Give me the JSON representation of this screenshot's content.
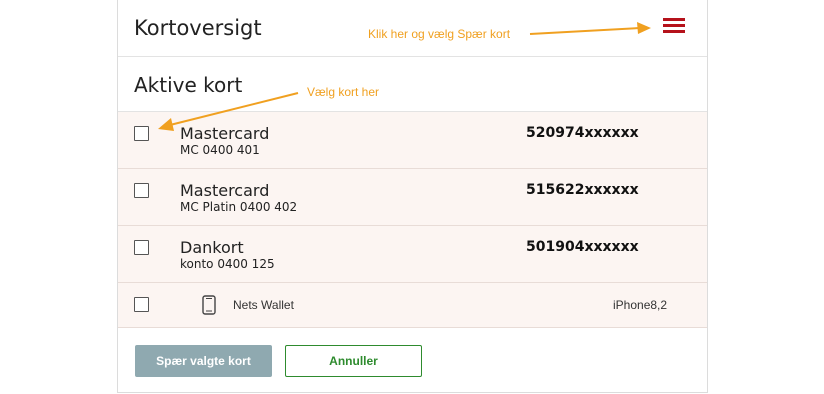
{
  "header": {
    "title": "Kortoversigt",
    "menu_icon": "hamburger-menu-icon",
    "menu_color": "#b5121b"
  },
  "section": {
    "title": "Aktive kort"
  },
  "cards": [
    {
      "name": "Mastercard",
      "sub": "MC 0400 401",
      "number": "520974xxxxxx",
      "checked": false
    },
    {
      "name": "Mastercard",
      "sub": "MC Platin 0400 402",
      "number": "515622xxxxxx",
      "checked": false
    },
    {
      "name": "Dankort",
      "sub": "konto 0400 125",
      "number": "501904xxxxxx",
      "checked": false
    }
  ],
  "wallet": {
    "label": "Nets Wallet",
    "device": "iPhone8,2",
    "icon": "phone-icon",
    "checked": false
  },
  "buttons": {
    "block_label": "Spær valgte kort",
    "cancel_label": "Annuller"
  },
  "annotations": {
    "menu_hint": "Klik her og vælg Spær kort",
    "card_hint": "Vælg kort her",
    "color": "#f0a020"
  }
}
